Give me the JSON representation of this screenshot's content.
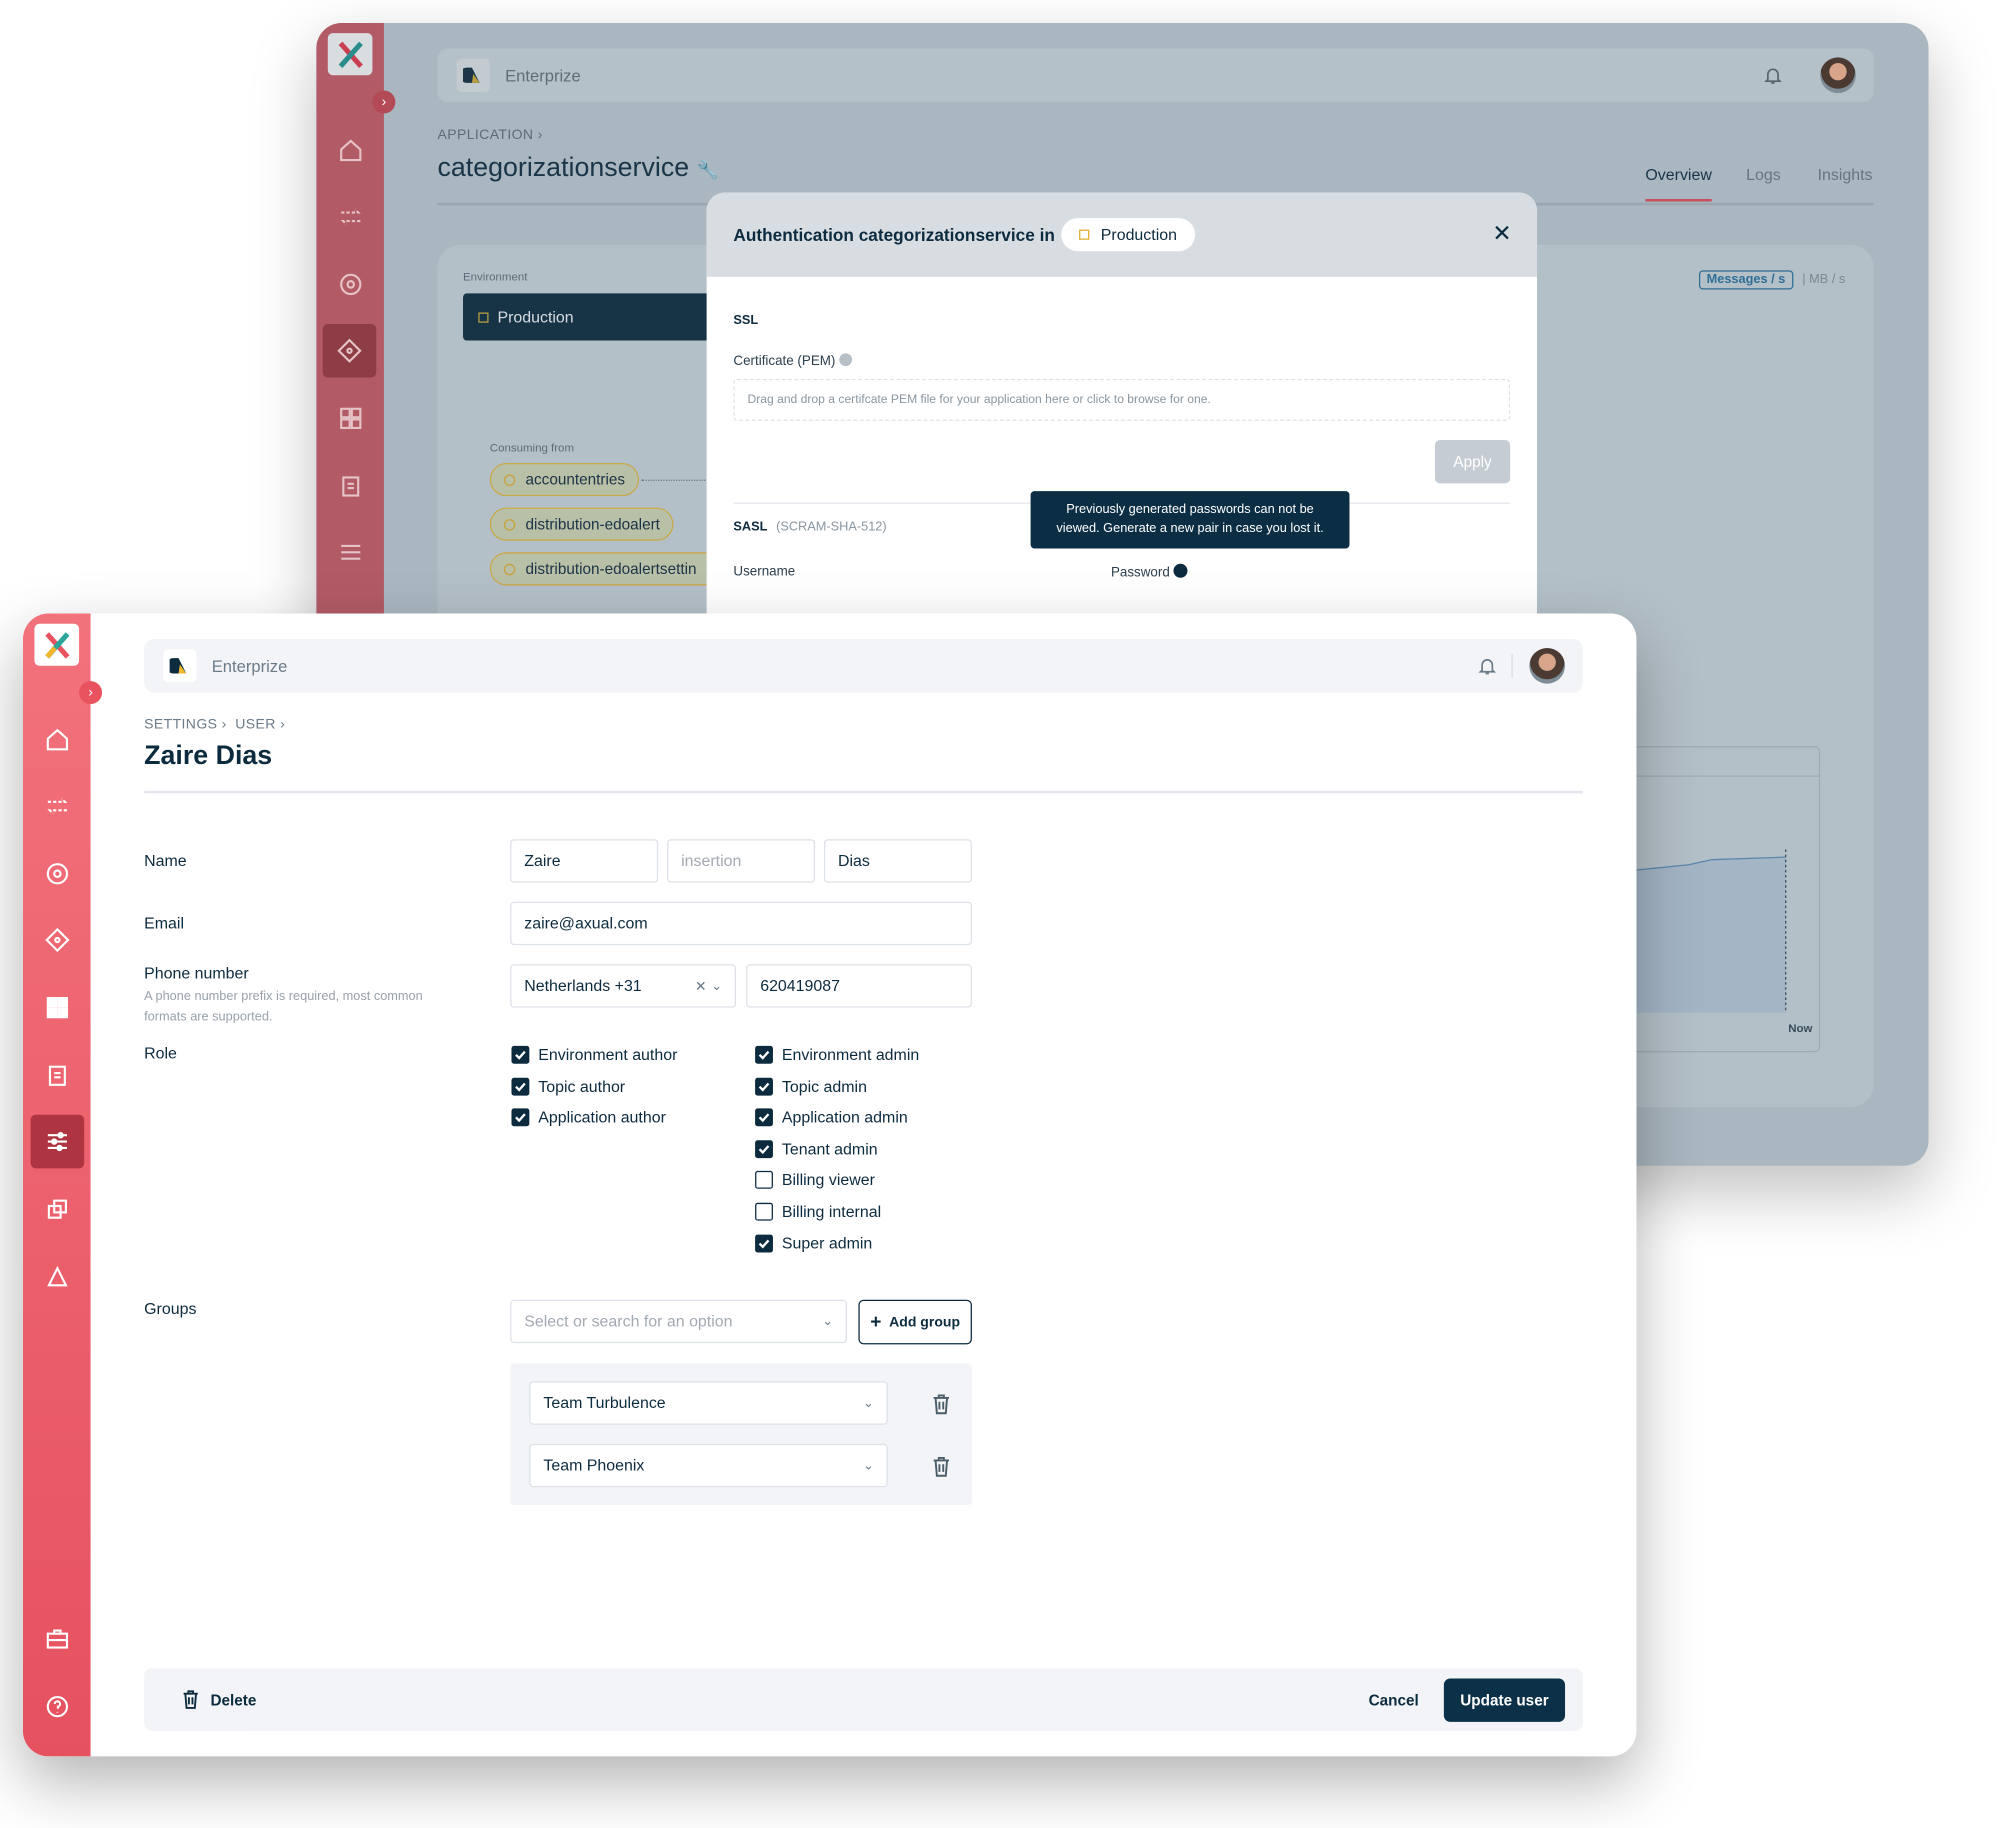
{
  "brand": {
    "org_name": "Enterprize",
    "accent": "#e9525f",
    "dark": "#0b3047"
  },
  "back_window": {
    "breadcrumb": "APPLICATION",
    "title": "categorizationservice",
    "tabs": [
      {
        "label": "Overview",
        "active": true
      },
      {
        "label": "Logs"
      },
      {
        "label": "Insights"
      }
    ],
    "environment_label": "Environment",
    "environment_value": "Production",
    "consuming_label": "Consuming from",
    "consuming": [
      "accountentries",
      "distribution-edoalert",
      "distribution-edoalertsettin"
    ],
    "chart_toggle": {
      "active": "Messages / s",
      "other": "MB / s"
    },
    "chart_x_label": "Now",
    "modal": {
      "title": "Authentication categorizationservice in",
      "env_chip": "Production",
      "ssl_heading": "SSL",
      "cert_label": "Certificate (PEM)",
      "dropzone_text": "Drag and drop a certifcate PEM file for your application here or click to browse for one.",
      "apply_label": "Apply",
      "sasl_heading": "SASL",
      "sasl_mech": "(SCRAM-SHA-512)",
      "username_label": "Username",
      "password_label": "Password",
      "tooltip": "Previously generated passwords can not be viewed. Generate a new pair in case you lost it."
    }
  },
  "front_window": {
    "breadcrumb": [
      "SETTINGS",
      "USER"
    ],
    "title": "Zaire Dias",
    "form": {
      "name_label": "Name",
      "first_name": "Zaire",
      "insertion_placeholder": "insertion",
      "last_name": "Dias",
      "email_label": "Email",
      "email": "zaire@axual.com",
      "phone_label": "Phone number",
      "phone_help": "A phone number prefix is required, most common formats are supported.",
      "phone_prefix": "Netherlands +31",
      "phone_number": "620419087",
      "role_label": "Role",
      "roles_left": [
        {
          "label": "Environment author",
          "checked": true
        },
        {
          "label": "Topic author",
          "checked": true
        },
        {
          "label": "Application author",
          "checked": true
        }
      ],
      "roles_right": [
        {
          "label": "Environment admin",
          "checked": true
        },
        {
          "label": "Topic admin",
          "checked": true
        },
        {
          "label": "Application admin",
          "checked": true
        },
        {
          "label": "Tenant admin",
          "checked": true
        },
        {
          "label": "Billing viewer",
          "checked": false
        },
        {
          "label": "Billing internal",
          "checked": false
        },
        {
          "label": "Super admin",
          "checked": true
        }
      ],
      "groups_label": "Groups",
      "groups_placeholder": "Select or search for an option",
      "add_group_label": "Add group",
      "groups": [
        "Team Turbulence",
        "Team Phoenix"
      ]
    },
    "footer": {
      "delete_label": "Delete",
      "cancel_label": "Cancel",
      "update_label": "Update user"
    }
  }
}
